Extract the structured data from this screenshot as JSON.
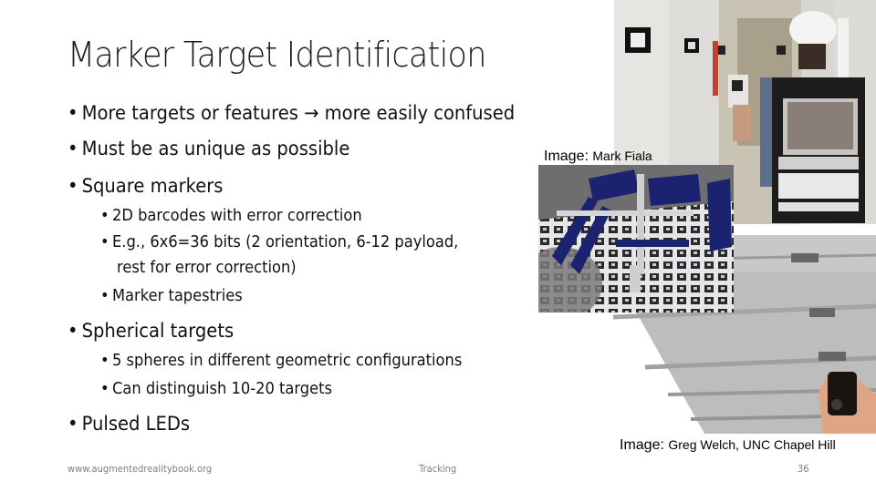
{
  "slide": {
    "title": "Marker Target Identification",
    "bullets": [
      {
        "level": 1,
        "text": "More targets or features → more easily confused"
      },
      {
        "level": 1,
        "text": "Must be as unique as possible"
      },
      {
        "level": 1,
        "text": "Square markers"
      },
      {
        "level": 2,
        "text": "2D barcodes with error correction"
      },
      {
        "level": 2,
        "text": "E.g., 6x6=36 bits (2 orientation, 6-12 payload,"
      },
      {
        "level": 2,
        "text": "rest for error correction)",
        "continuation": true
      },
      {
        "level": 2,
        "text": "Marker tapestries"
      },
      {
        "level": 1,
        "text": "Spherical targets"
      },
      {
        "level": 2,
        "text": "5 spheres in different geometric configurations"
      },
      {
        "level": 2,
        "text": "Can distinguish 10-20 targets"
      },
      {
        "level": 1,
        "text": "Pulsed LEDs"
      }
    ],
    "bullet_glyph": "•",
    "images": [
      {
        "name": "backpack-ar-photo",
        "alt": "Person with helmet and backpack laptop walking in corridor with square markers on walls"
      },
      {
        "name": "iss-marker-tapestry-photo",
        "alt": "Space station model rendered over marker tapestry"
      },
      {
        "name": "ceiling-led-tracker-photo",
        "alt": "Hand holding tracker under ceiling panels with LEDs"
      }
    ],
    "captions": {
      "fiala": {
        "label": "Image:",
        "credit": "Mark Fiala"
      },
      "welch": {
        "label": "Image:",
        "credit": "Greg Welch, UNC Chapel Hill"
      }
    }
  },
  "footer": {
    "website": "www.augmentedrealitybook.org",
    "section": "Tracking",
    "page_number": "36"
  }
}
